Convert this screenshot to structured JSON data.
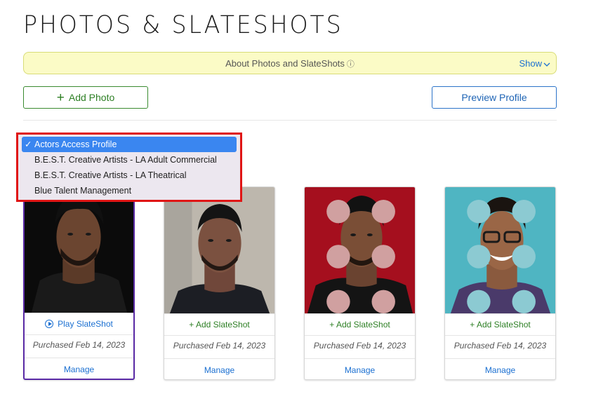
{
  "page": {
    "title": "PHOTOS & SLATESHOTS"
  },
  "banner": {
    "text": "About Photos and SlateShots",
    "info_icon": "ⓘ",
    "toggle_label": "Show",
    "toggle_icon": "chevron-down"
  },
  "toolbar": {
    "add_photo_label": "Add Photo",
    "add_icon": "+",
    "preview_label": "Preview Profile"
  },
  "profile_dropdown": {
    "selected_index": 0,
    "check_glyph": "✓",
    "options": [
      "Actors Access Profile",
      "B.E.S.T. Creative Artists - LA Adult Commercial",
      "B.E.S.T. Creative Artists - LA Theatrical",
      "Blue Talent Management"
    ]
  },
  "photos": [
    {
      "slate_label": "Play SlateShot",
      "slate_type": "play",
      "purchased": "Purchased Feb 14, 2023",
      "manage_label": "Manage",
      "selected": true,
      "bg_color": "#0b0b0b"
    },
    {
      "slate_label": "+ Add SlateShot",
      "slate_type": "add",
      "purchased": "Purchased Feb 14, 2023",
      "manage_label": "Manage",
      "selected": false,
      "bg_color": "#bdb7ad"
    },
    {
      "slate_label": "+ Add SlateShot",
      "slate_type": "add",
      "purchased": "Purchased Feb 14, 2023",
      "manage_label": "Manage",
      "selected": false,
      "bg_color": "#a50f1e"
    },
    {
      "slate_label": "+ Add SlateShot",
      "slate_type": "add",
      "purchased": "Purchased Feb 14, 2023",
      "manage_label": "Manage",
      "selected": false,
      "bg_color": "#4fb5c2"
    }
  ],
  "colors": {
    "accent_green": "#2d7f24",
    "accent_blue": "#1a6fd1",
    "banner_bg": "#fbfbc6",
    "highlight_red": "#e01515",
    "selected_border": "#5a2aa6"
  }
}
